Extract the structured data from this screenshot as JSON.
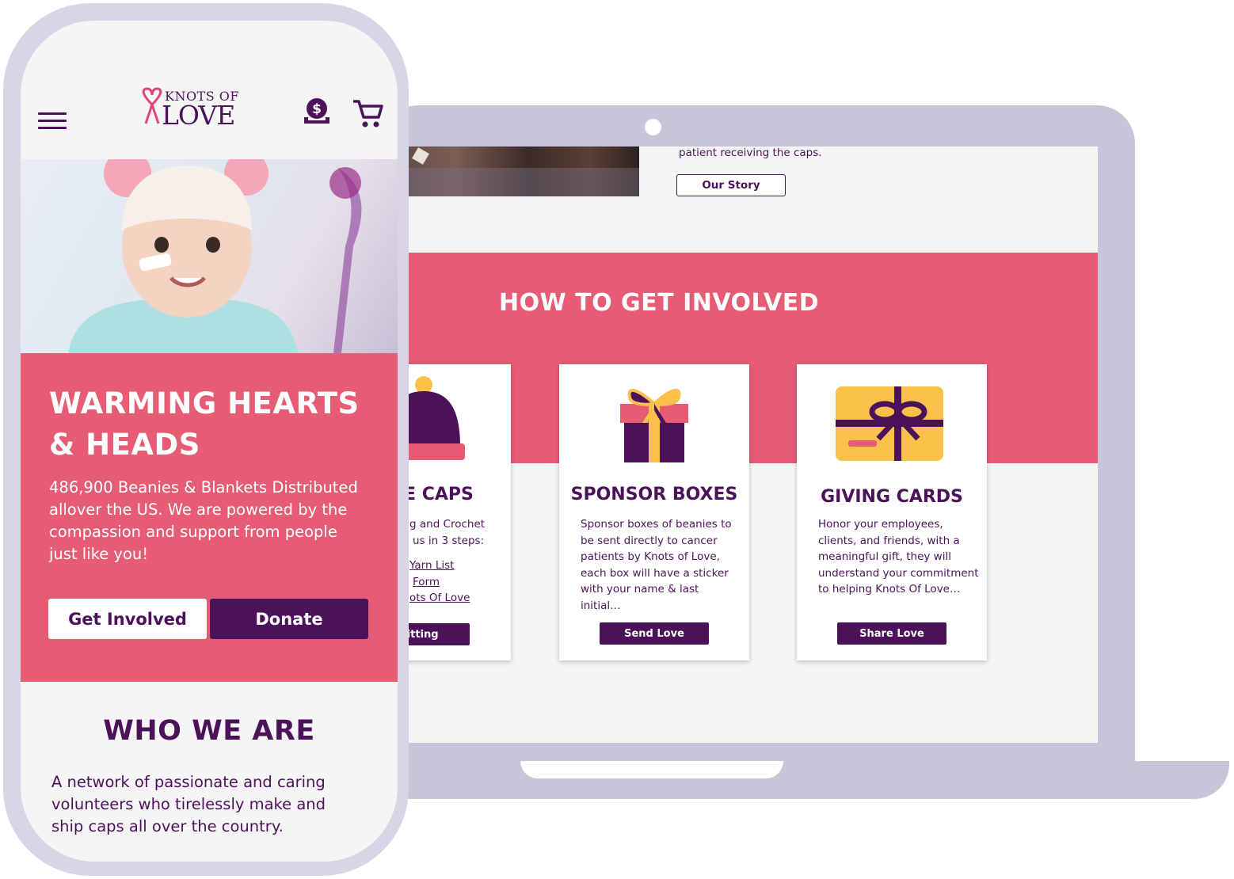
{
  "colors": {
    "brand_purple": "#4b1259",
    "brand_pink": "#e65c74",
    "device_gray": "#c7c6d9",
    "gold": "#f9c04a",
    "background": "#f5f5f5"
  },
  "laptop": {
    "story": {
      "text": "patient receiving the caps.",
      "button_label": "Our Story"
    },
    "section_title": "HOW TO GET INVOLVED",
    "cards": [
      {
        "icon": "knit-cap-icon",
        "title": "TE CAPS",
        "desc_lines": [
          "g and Crochet",
          "us in 3 steps:"
        ],
        "links": [
          "Yarn List",
          "Form",
          "ots Of Love"
        ],
        "button_label": "Knitting"
      },
      {
        "icon": "gift-box-icon",
        "title": "SPONSOR BOXES",
        "desc": "Sponsor boxes of beanies to be sent directly to cancer patients by Knots of Love, each box will have a sticker with your name & last initial…",
        "button_label": "Send Love"
      },
      {
        "icon": "gift-card-icon",
        "title": "GIVING CARDS",
        "desc": "Honor your employees, clients, and friends, with a meaningful gift, they will understand your commitment to helping Knots Of Love…",
        "button_label": "Share Love"
      }
    ]
  },
  "phone": {
    "header": {
      "logo_line1": "KNOTS OF",
      "logo_line2": "LOVE",
      "menu_icon": "hamburger-icon",
      "donate_icon": "donate-dollar-icon",
      "cart_icon": "shopping-cart-icon"
    },
    "hero": {
      "title": "WARMING HEARTS & HEADS",
      "text": "486,900 Beanies & Blankets Distributed allover the US. We are powered by the compassion and support from people just like you!",
      "primary_button": "Get Involved",
      "secondary_button": "Donate"
    },
    "who": {
      "title": "WHO WE ARE",
      "text": "A network of passionate and caring volunteers who tirelessly make and ship caps all over the country."
    }
  }
}
